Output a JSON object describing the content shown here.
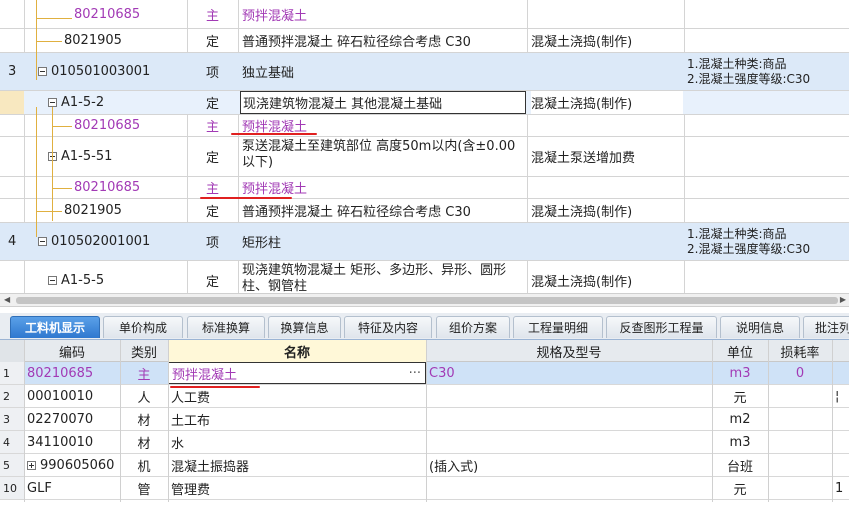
{
  "upper_rows": [
    {
      "kind": "material",
      "num": "",
      "code": "80210685",
      "type": "主",
      "name": "预拌混凝土",
      "content": "",
      "features": []
    },
    {
      "kind": "sub",
      "num": "",
      "code": "8021905",
      "type": "定",
      "name": "普通预拌混凝土 碎石粒径综合考虑 C30",
      "content": "混凝土浇捣(制作)",
      "features": []
    },
    {
      "kind": "item",
      "num": "3",
      "code": "010501003001",
      "type": "项",
      "name": "独立基础",
      "content": "",
      "features": [
        "1.混凝土种类:商品",
        "2.混凝土强度等级:C30"
      ]
    },
    {
      "kind": "quota-selected",
      "num": "",
      "code": "A1-5-2",
      "type": "定",
      "name": "现浇建筑物混凝土 其他混凝土基础",
      "content": "混凝土浇捣(制作)",
      "features": []
    },
    {
      "kind": "material",
      "num": "",
      "code": "80210685",
      "type": "主",
      "name": "预拌混凝土",
      "content": "",
      "features": []
    },
    {
      "kind": "quota",
      "num": "",
      "code": "A1-5-51",
      "type": "定",
      "name": "泵送混凝土至建筑部位 高度50m以内(含±0.00以下)",
      "content": "混凝土泵送增加费",
      "features": []
    },
    {
      "kind": "material",
      "num": "",
      "code": "80210685",
      "type": "主",
      "name": "预拌混凝土",
      "content": "",
      "features": []
    },
    {
      "kind": "sub",
      "num": "",
      "code": "8021905",
      "type": "定",
      "name": "普通预拌混凝土 碎石粒径综合考虑 C30",
      "content": "混凝土浇捣(制作)",
      "features": []
    },
    {
      "kind": "item",
      "num": "4",
      "code": "010502001001",
      "type": "项",
      "name": "矩形柱",
      "content": "",
      "features": [
        "1.混凝土种类:商品",
        "2.混凝土强度等级:C30"
      ]
    },
    {
      "kind": "quota",
      "num": "",
      "code": "A1-5-5",
      "type": "定",
      "name": "现浇建筑物混凝土 矩形、多边形、异形、圆形柱、钢管柱",
      "content": "混凝土浇捣(制作)",
      "features": []
    }
  ],
  "tabs": [
    "工料机显示",
    "单价构成",
    "标准换算",
    "换算信息",
    "特征及内容",
    "组价方案",
    "工程量明细",
    "反查图形工程量",
    "说明信息",
    "批注列"
  ],
  "lower_headers": {
    "code": "编码",
    "type": "类别",
    "name": "名称",
    "spec": "规格及型号",
    "unit": "单位",
    "loss": "损耗率"
  },
  "lower_rows": [
    {
      "num": "1",
      "code": "80210685",
      "type": "主",
      "name": "预拌混凝土",
      "spec": "C30",
      "unit": "m3",
      "loss": "0",
      "extra": "",
      "ellipsis": "···",
      "expand": false
    },
    {
      "num": "2",
      "code": "00010010",
      "type": "人",
      "name": "人工费",
      "spec": "",
      "unit": "元",
      "loss": "",
      "extra": "¦",
      "ellipsis": "",
      "expand": false
    },
    {
      "num": "3",
      "code": "02270070",
      "type": "材",
      "name": "土工布",
      "spec": "",
      "unit": "m2",
      "loss": "",
      "extra": "",
      "ellipsis": "",
      "expand": false
    },
    {
      "num": "4",
      "code": "34110010",
      "type": "材",
      "name": "水",
      "spec": "",
      "unit": "m3",
      "loss": "",
      "extra": "",
      "ellipsis": "",
      "expand": false
    },
    {
      "num": "5",
      "code": "990605060",
      "type": "机",
      "name": "混凝土振捣器",
      "spec": "(插入式)",
      "unit": "台班",
      "loss": "",
      "extra": "",
      "ellipsis": "",
      "expand": true
    },
    {
      "num": "10",
      "code": "GLF",
      "type": "管",
      "name": "管理费",
      "spec": "",
      "unit": "元",
      "loss": "",
      "extra": "1",
      "ellipsis": "",
      "expand": false
    }
  ],
  "colors": {
    "material": "#a23ab5",
    "item_bg": "#dce9f8",
    "accent": "#2f78cf",
    "annotation": "#e02020"
  }
}
